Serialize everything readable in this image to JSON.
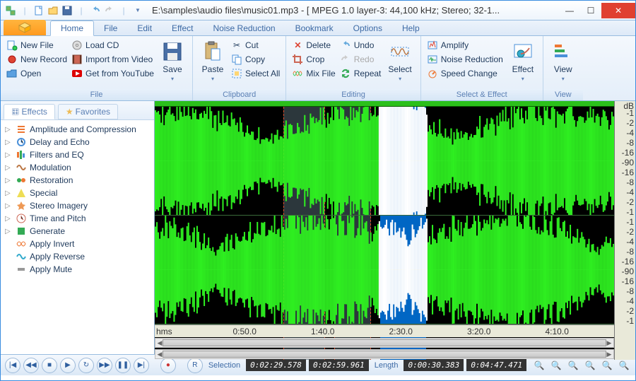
{
  "title": "E:\\samples\\audio files\\music01.mp3 - [ MPEG 1.0 layer-3: 44,100 kHz; Stereo; 32-1...",
  "tabs": [
    "Home",
    "File",
    "Edit",
    "Effect",
    "Noise Reduction",
    "Bookmark",
    "Options",
    "Help"
  ],
  "active_tab": 0,
  "ribbon": {
    "file": {
      "label": "File",
      "new_file": "New File",
      "new_record": "New Record",
      "open": "Open",
      "load_cd": "Load CD",
      "import_video": "Import from Video",
      "get_youtube": "Get from YouTube",
      "save": "Save"
    },
    "clip": {
      "label": "Clipboard",
      "paste": "Paste",
      "cut": "Cut",
      "copy": "Copy",
      "select_all": "Select All"
    },
    "edit": {
      "label": "Editing",
      "delete": "Delete",
      "crop": "Crop",
      "mix": "Mix File",
      "undo": "Undo",
      "redo": "Redo",
      "repeat": "Repeat",
      "select": "Select"
    },
    "sel": {
      "label": "Select & Effect",
      "amplify": "Amplify",
      "noise": "Noise Reduction",
      "speed": "Speed Change",
      "effect": "Effect"
    },
    "view": {
      "label": "View",
      "view": "View"
    }
  },
  "sidebar": {
    "effects_tab": "Effects",
    "fav_tab": "Favorites",
    "items": [
      {
        "label": "Amplitude and Compression",
        "expand": true
      },
      {
        "label": "Delay and Echo",
        "expand": true
      },
      {
        "label": "Filters and EQ",
        "expand": true
      },
      {
        "label": "Modulation",
        "expand": true
      },
      {
        "label": "Restoration",
        "expand": true
      },
      {
        "label": "Special",
        "expand": true
      },
      {
        "label": "Stereo Imagery",
        "expand": true
      },
      {
        "label": "Time and Pitch",
        "expand": true
      },
      {
        "label": "Generate",
        "expand": true
      },
      {
        "label": "Apply Invert",
        "expand": false
      },
      {
        "label": "Apply Reverse",
        "expand": false
      },
      {
        "label": "Apply Mute",
        "expand": false
      }
    ]
  },
  "timeline": {
    "unit": "hms",
    "ticks": [
      "0:50.0",
      "1:40.0",
      "2:30.0",
      "3:20.0",
      "4:10.0"
    ]
  },
  "db": {
    "head": "dB",
    "vals": [
      "-1",
      "-2",
      "-4",
      "-8",
      "-16",
      "-90",
      "-16",
      "-8",
      "-4",
      "-2",
      "-1"
    ]
  },
  "play": {
    "sel_label": "Selection",
    "sel_from": "0:02:29.578",
    "sel_to": "0:02:59.961",
    "len_label": "Length",
    "len_sel": "0:00:30.383",
    "len_total": "0:04:47.471"
  }
}
